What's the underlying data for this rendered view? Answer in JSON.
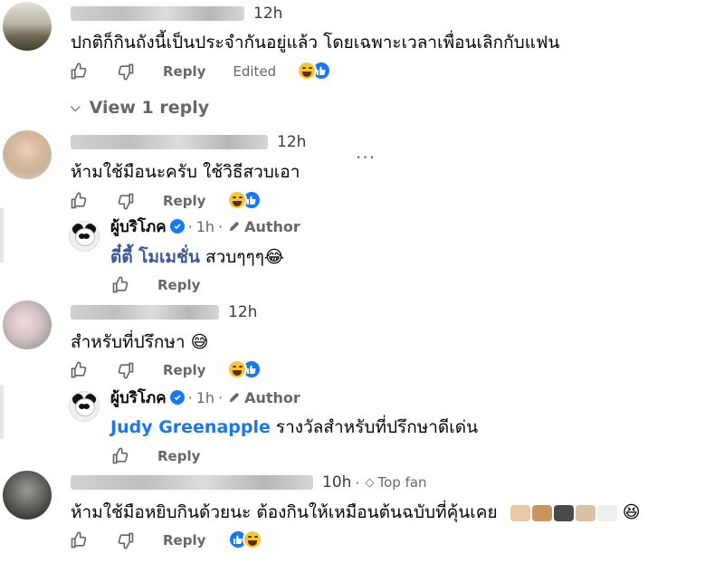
{
  "comments": [
    {
      "time": "12h",
      "text": "ปกติก็กินถังนี้เป็นประจำกันอยู่แล้ว โดยเฉพาะเวลาเพื่อนเลิกกับแฟน",
      "reply_label": "Reply",
      "edited_label": "Edited",
      "view_replies": "View 1 reply"
    },
    {
      "time": "12h",
      "text": "ห้ามใช้มือนะครับ ใช้วิธีสวบเอา",
      "reply_label": "Reply",
      "more": "···",
      "reply": {
        "page_name": "ผู้บริโภค",
        "time": "1h",
        "author_label": "Author",
        "mention": "ตี๋ตี้ โมเมชั่น",
        "text": " สวบๆๆๆ😂",
        "reply_label": "Reply"
      }
    },
    {
      "time": "12h",
      "text": "สำหรับที่ปรึกษา 😅",
      "reply_label": "Reply",
      "reply": {
        "page_name": "ผู้บริโภค",
        "time": "1h",
        "author_label": "Author",
        "mention": "Judy Greenapple",
        "text": " รางวัลสำหรับที่ปรึกษาดีเด่น",
        "reply_label": "Reply"
      }
    },
    {
      "time": "10h",
      "badge": "Top fan",
      "text": "ห้ามใช้มือหยิบกินด้วยนะ ต้องกินให้เหมือนต้นฉบับที่คุ้นเคย",
      "trailing_emoji": "😆",
      "reply_label": "Reply"
    }
  ],
  "separator_dot": "·",
  "colors": {
    "accent": "#1877f2",
    "secondary_text": "#65676b",
    "reaction_haha": "#f7c531"
  },
  "icons": [
    "like-icon",
    "dislike-icon",
    "haha-reaction-icon",
    "like-reaction-icon",
    "verified-icon",
    "pencil-icon",
    "diamond-icon",
    "chevron-down-icon"
  ]
}
